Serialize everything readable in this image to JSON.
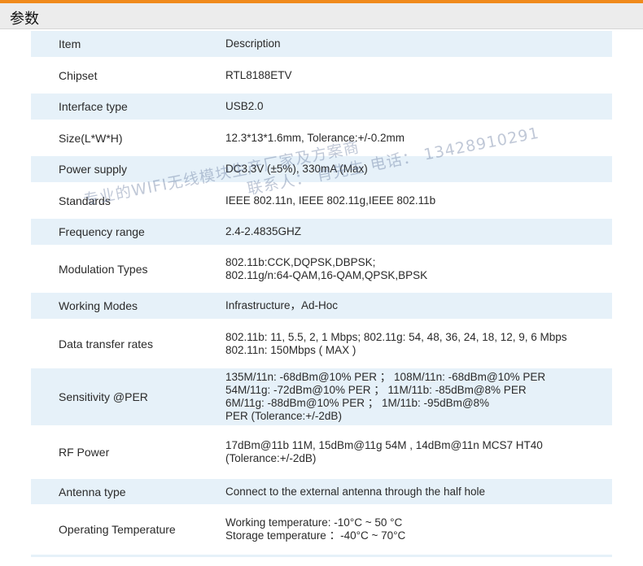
{
  "header": {
    "title": "参数"
  },
  "table": {
    "columns": {
      "item": "Item",
      "description": "Description"
    },
    "rows": [
      {
        "item": "Chipset",
        "lines": [
          "RTL8188ETV"
        ]
      },
      {
        "item": "Interface type",
        "lines": [
          "USB2.0"
        ]
      },
      {
        "item": "Size(L*W*H)",
        "lines": [
          "12.3*13*1.6mm, Tolerance:+/-0.2mm"
        ]
      },
      {
        "item": "Power supply",
        "lines": [
          "DC3.3V (±5%), 330mA (Max)"
        ]
      },
      {
        "item": "Standards",
        "lines": [
          "IEEE 802.11n, IEEE 802.11g,IEEE 802.11b"
        ]
      },
      {
        "item": "Frequency range",
        "lines": [
          "2.4-2.4835GHZ"
        ]
      },
      {
        "item": "Modulation Types",
        "lines": [
          "802.11b:CCK,DQPSK,DBPSK;",
          "802.11g/n:64-QAM,16-QAM,QPSK,BPSK"
        ]
      },
      {
        "item": "Working Modes",
        "lines": [
          "Infrastructure，Ad-Hoc"
        ]
      },
      {
        "item": "Data transfer rates",
        "lines": [
          "802.11b: 11, 5.5, 2, 1 Mbps; 802.11g: 54, 48, 36, 24, 18, 12, 9, 6 Mbps",
          "802.11n: 150Mbps ( MAX )"
        ]
      },
      {
        "item": "Sensitivity @PER",
        "lines": [
          "135M/11n: -68dBm@10% PER ； 108M/11n: -68dBm@10% PER",
          "54M/11g: -72dBm@10% PER ；  11M/11b: -85dBm@8% PER",
          "6M/11g: -88dBm@10% PER ；   1M/11b: -95dBm@8%",
          "PER (Tolerance:+/-2dB)"
        ]
      },
      {
        "item": "RF Power",
        "lines": [
          "17dBm@11b 11M, 15dBm@11g 54M , 14dBm@11n MCS7 HT40",
          "(Tolerance:+/-2dB)"
        ]
      },
      {
        "item": "Antenna type",
        "lines": [
          "Connect to the external antenna through the half hole"
        ]
      },
      {
        "item": "Operating Temperature",
        "lines": [
          "Working temperature: -10°C ~ 50 °C",
          "Storage temperature  ：-40°C ~ 70°C"
        ]
      }
    ]
  },
  "watermark": {
    "line1": "专业的WIFI无线模块生产厂家及方案商",
    "line2": "联系人：  肖先生  电话：  13428910291"
  }
}
